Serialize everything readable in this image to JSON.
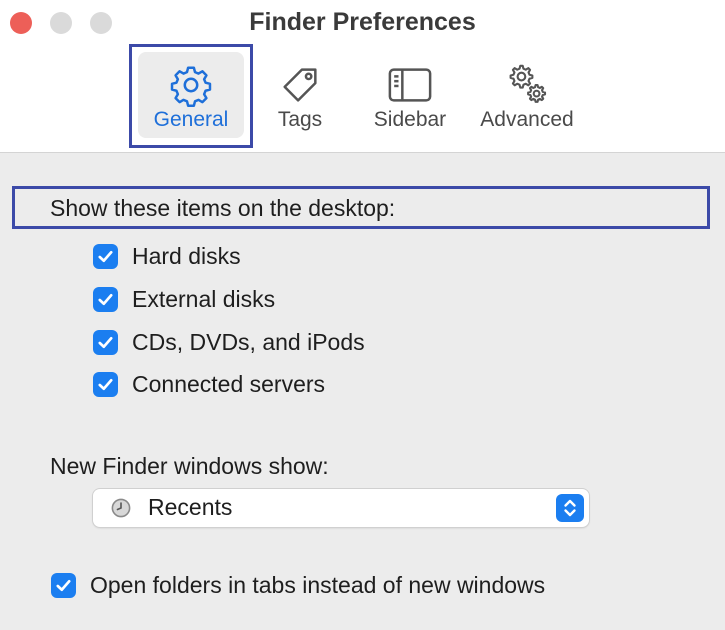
{
  "window": {
    "title": "Finder Preferences"
  },
  "toolbar": {
    "tabs": [
      {
        "label": "General",
        "icon": "gear-icon",
        "active": true
      },
      {
        "label": "Tags",
        "icon": "tag-icon",
        "active": false
      },
      {
        "label": "Sidebar",
        "icon": "sidebar-icon",
        "active": false
      },
      {
        "label": "Advanced",
        "icon": "gears-icon",
        "active": false
      }
    ]
  },
  "desktop": {
    "heading": "Show these items on the desktop:",
    "items": [
      {
        "label": "Hard disks",
        "checked": true
      },
      {
        "label": "External disks",
        "checked": true
      },
      {
        "label": "CDs, DVDs, and iPods",
        "checked": true
      },
      {
        "label": "Connected servers",
        "checked": true
      }
    ]
  },
  "new_windows": {
    "label": "New Finder windows show:",
    "selected": "Recents",
    "icon": "clock-icon"
  },
  "open_in_tabs": {
    "label": "Open folders in tabs instead of new windows",
    "checked": true
  },
  "colors": {
    "accent": "#1b7ef0",
    "highlight_box": "#3c4aa8",
    "close_button": "#ed5f58"
  }
}
